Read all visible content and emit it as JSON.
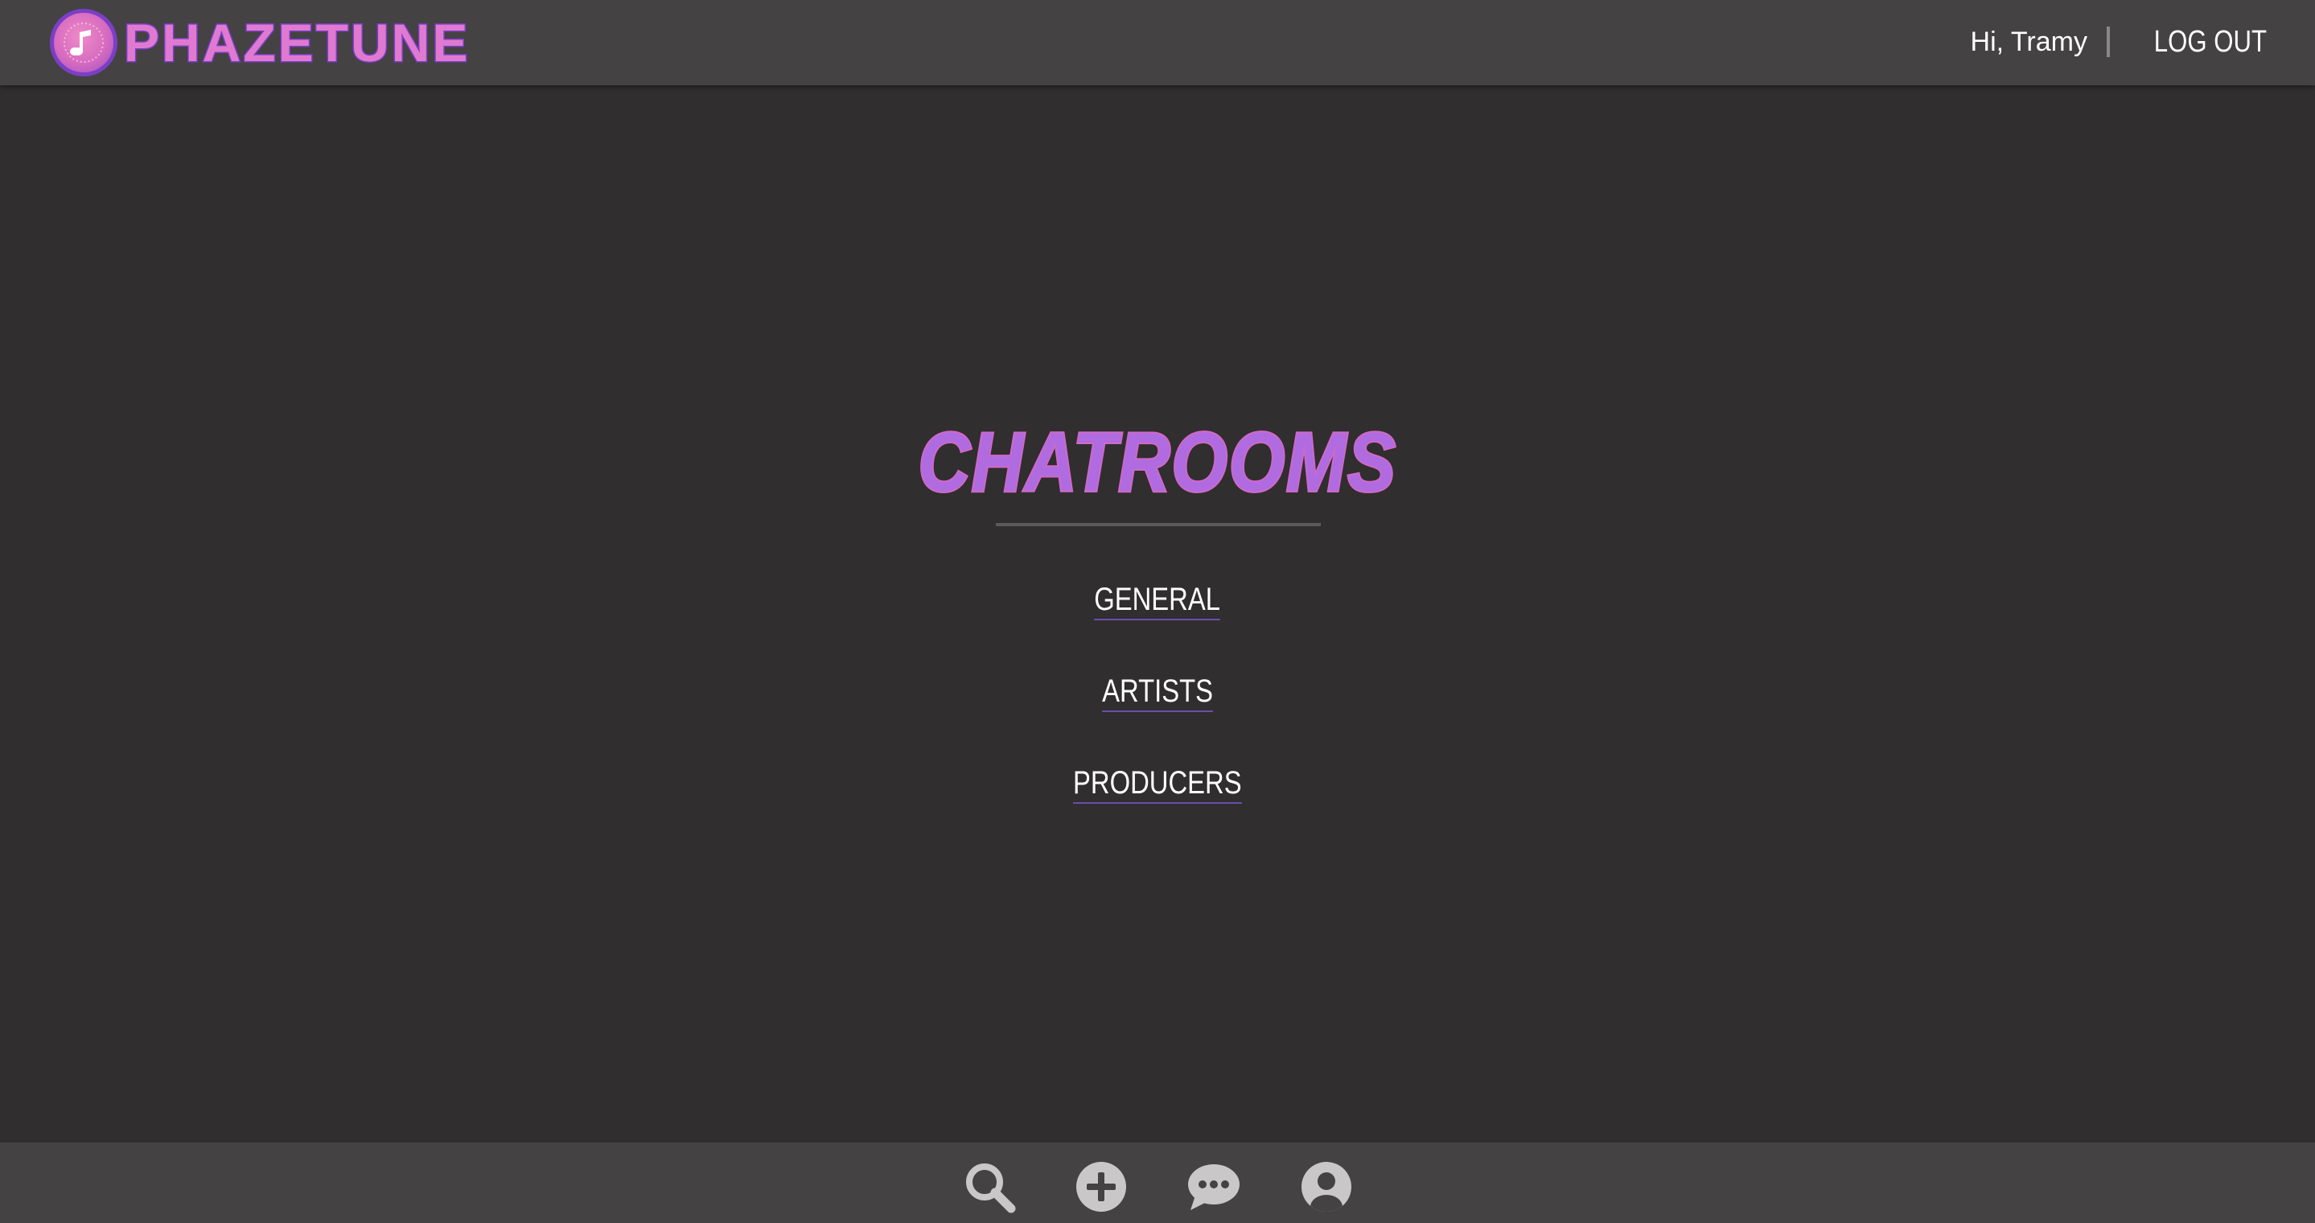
{
  "header": {
    "brand": "PHAZETUNE",
    "greeting": "Hi, Tramy",
    "logout_label": "LOG OUT"
  },
  "main": {
    "title": "CHATROOMS",
    "rooms": [
      {
        "label": "GENERAL"
      },
      {
        "label": "ARTISTS"
      },
      {
        "label": "PRODUCERS"
      }
    ]
  },
  "bottom_nav": {
    "icons": [
      "search-icon",
      "plus-circle-icon",
      "chat-bubble-icon",
      "user-circle-icon"
    ]
  },
  "colors": {
    "background": "#302e2f",
    "bar": "#444243",
    "accent_pink": "#e07ad0",
    "accent_purple": "#7b3fc7",
    "icon_gray": "#c9c7c8"
  }
}
